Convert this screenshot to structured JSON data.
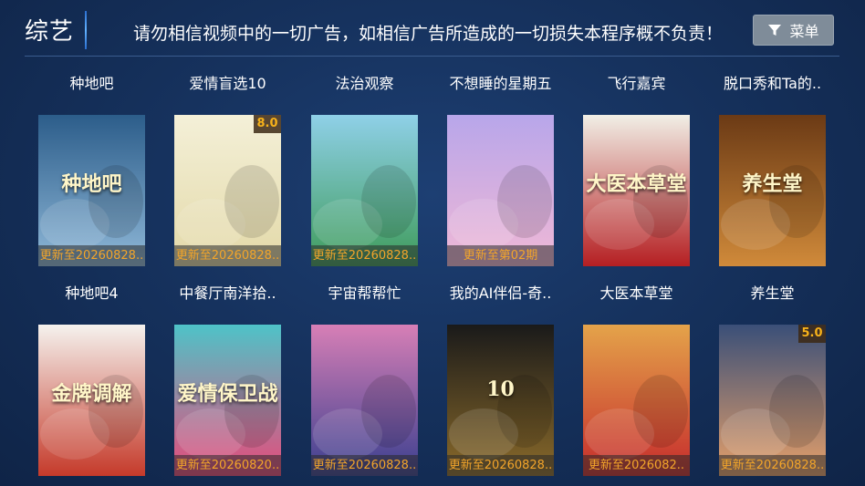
{
  "header": {
    "title": "综艺",
    "notice": "请勿相信视频中的一切广告，如相信广告所造成的一切损失本程序概不负责！",
    "menu_label": "菜单"
  },
  "colors": {
    "background": "#16325e",
    "accent_line": "#63b3ff",
    "update_text": "#f3a52a",
    "score_text": "#f7b21a",
    "menu_button": "#7f8c99"
  },
  "rows": [
    {
      "items": [
        {
          "title": "种地吧",
          "poster_text": "种地吧",
          "update": "更新至20260828..",
          "score": "",
          "palette": [
            "#2c5d8a",
            "#8fb8d8"
          ]
        },
        {
          "title": "爱情盲选10",
          "poster_text": "",
          "update": "更新至20260828..",
          "score": "8.0",
          "palette": [
            "#f4f0d8",
            "#e3d9a8"
          ]
        },
        {
          "title": "法治观察",
          "poster_text": "",
          "update": "更新至20260828..",
          "score": "",
          "palette": [
            "#8fd0e8",
            "#3e9b5a"
          ]
        },
        {
          "title": "不想睡的星期五",
          "poster_text": "",
          "update": "更新至第02期",
          "score": "",
          "palette": [
            "#b8a6ea",
            "#f0b8d6"
          ]
        },
        {
          "title": "飞行嘉宾",
          "poster_text": "大医本草堂",
          "update": "",
          "score": "",
          "palette": [
            "#f1efe6",
            "#b51f22"
          ]
        },
        {
          "title": "脱口秀和Ta的..",
          "poster_text": "养生堂",
          "update": "",
          "score": "",
          "palette": [
            "#6b3a15",
            "#d08a3a"
          ]
        }
      ]
    },
    {
      "items": [
        {
          "title": "种地吧4",
          "poster_text": "金牌调解",
          "update": "",
          "score": "",
          "palette": [
            "#f5f2ee",
            "#c53a2a"
          ]
        },
        {
          "title": "中餐厅南洋拾..",
          "poster_text": "爱情保卫战",
          "update": "更新至20260820..",
          "score": "",
          "palette": [
            "#4ec3c8",
            "#e84a7a"
          ]
        },
        {
          "title": "宇宙帮帮忙",
          "poster_text": "",
          "update": "更新至20260828..",
          "score": "",
          "palette": [
            "#d77fb6",
            "#3a3f8f"
          ]
        },
        {
          "title": "我的AI伴侣-奇..",
          "poster_text": "10",
          "update": "更新至20260828..",
          "score": "",
          "palette": [
            "#1a1a1a",
            "#8a6a2a"
          ]
        },
        {
          "title": "大医本草堂",
          "poster_text": "",
          "update": "更新至2026082..",
          "score": "",
          "palette": [
            "#e4a34a",
            "#c62c2c"
          ]
        },
        {
          "title": "养生堂",
          "poster_text": "",
          "update": "更新至20260828..",
          "score": "5.0",
          "palette": [
            "#3a4f78",
            "#e6a06a"
          ]
        }
      ]
    }
  ]
}
